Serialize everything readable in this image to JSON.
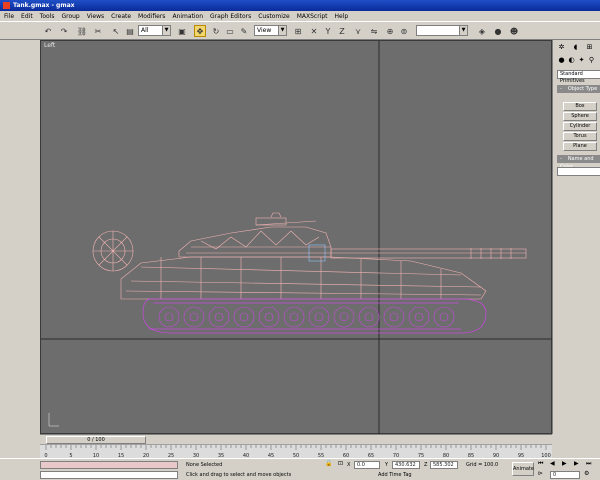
{
  "window": {
    "title": "Tank.gmax - gmax"
  },
  "menu": [
    "File",
    "Edit",
    "Tools",
    "Group",
    "Views",
    "Create",
    "Modifiers",
    "Animation",
    "Graph Editors",
    "Customize",
    "MAXScript",
    "Help"
  ],
  "toolbar": {
    "selection_filter": "All",
    "reference_coord": "View"
  },
  "viewport": {
    "label": "Left"
  },
  "command_panel": {
    "primitive_type": "Standard Primitives",
    "object_type_title": "Object Type",
    "buttons": [
      "Box",
      "Sphere",
      "Cylinder",
      "Torus",
      "Plane"
    ],
    "name_color_title": "Name and Color"
  },
  "timeline": {
    "frame_counter": "0 / 100",
    "ticks": [
      "0",
      "5",
      "10",
      "15",
      "20",
      "25",
      "30",
      "35",
      "40",
      "45",
      "50",
      "55",
      "60",
      "65",
      "70",
      "75",
      "80",
      "85",
      "90",
      "95",
      "100"
    ]
  },
  "status": {
    "selection": "None Selected",
    "prompt": "Click and drag to select and move objects",
    "x_label": "X",
    "x_value": "0.0",
    "y_label": "Y",
    "y_value": "430.632",
    "z_label": "Z",
    "z_value": "585.302",
    "grid": "Grid = 100.0",
    "add_time_tag": "Add Time Tag",
    "animate": "Animate",
    "frame": "0"
  },
  "colors": {
    "wire_pink": "#f4b4b4",
    "wire_magenta": "#c848e0",
    "viewport_bg": "#6d6d6d"
  }
}
